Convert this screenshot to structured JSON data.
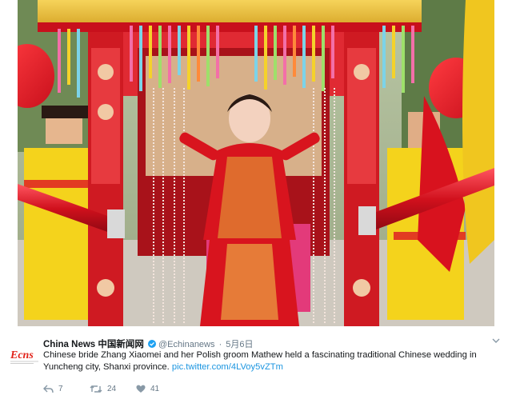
{
  "tweet": {
    "display_name": "China News 中国新闻网",
    "handle": "@Echinanews",
    "separator": "·",
    "time": "5月6日",
    "text": "Chinese bride Zhang Xiaomei and her Polish groom Mathew held a fascinating traditional Chinese wedding  in Yuncheng city, Shanxi province.",
    "link": "pic.twitter.com/4LVoy5vZTm",
    "avatar_label": "Ecns",
    "actions": {
      "reply_count": "7",
      "retweet_count": "24",
      "like_count": "41"
    }
  },
  "colors": {
    "link": "#1b95e0",
    "verified": "#1da1f2",
    "avatar_red": "#e2231a",
    "sedan_red": "#d61f26"
  },
  "icons": [
    "verified-icon",
    "caret-down-icon",
    "reply-icon",
    "retweet-icon",
    "like-icon"
  ]
}
